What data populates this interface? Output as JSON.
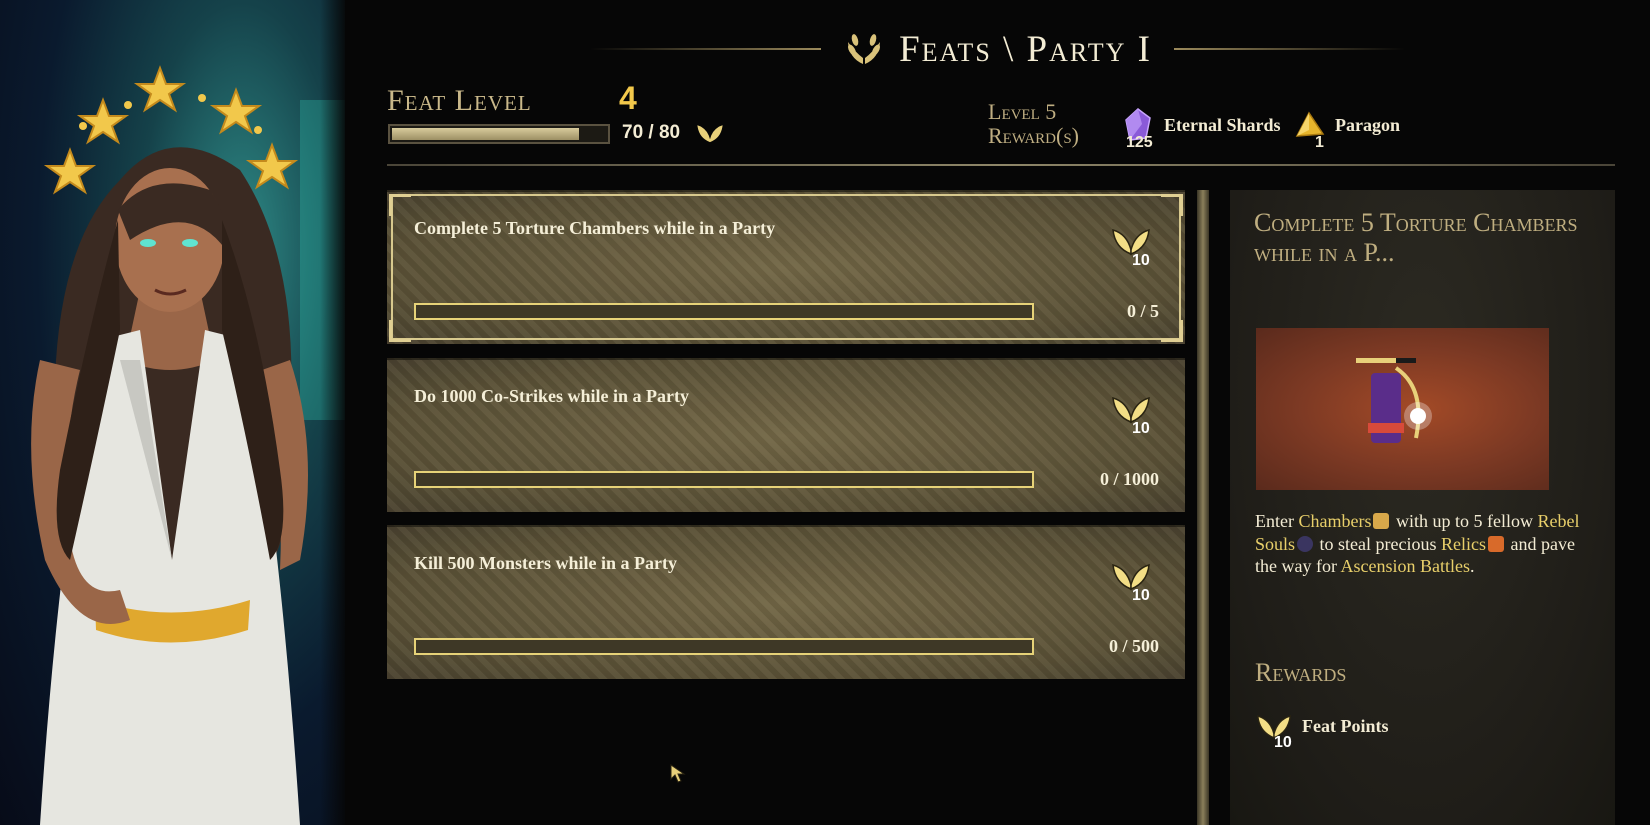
{
  "header": {
    "title": "Feats \\ Party I"
  },
  "feat_level": {
    "label": "Feat Level",
    "value": "4",
    "progress_text": "70 / 80",
    "progress_fraction": 0.875
  },
  "level_reward": {
    "label": "Level 5 Reward(s)",
    "items": [
      {
        "icon": "eternal-shard-icon",
        "count": "125",
        "name": "Eternal Shards"
      },
      {
        "icon": "paragon-icon",
        "count": "1",
        "name": "Paragon"
      }
    ]
  },
  "feats": [
    {
      "title": "Complete 5 Torture Chambers while in a Party",
      "points": "10",
      "progress_text": "0 / 5",
      "progress_fraction": 0,
      "selected": true
    },
    {
      "title": "Do 1000 Co-Strikes while in a Party",
      "points": "10",
      "progress_text": "0 / 1000",
      "progress_fraction": 0,
      "selected": false
    },
    {
      "title": "Kill 500 Monsters while in a Party",
      "points": "10",
      "progress_text": "0 / 500",
      "progress_fraction": 0,
      "selected": false
    }
  ],
  "detail": {
    "title": "Complete 5 Torture Chambers while in a P...",
    "desc": {
      "t1": "Enter ",
      "chambers": "Chambers",
      "t2": " with up to 5 fellow ",
      "rebel_souls": "Rebel Souls",
      "t3": " to steal precious ",
      "relics": "Relics",
      "t4": " and pave the way for ",
      "ascension": "Ascension Battles",
      "t5": "."
    },
    "rewards_heading": "Rewards",
    "reward": {
      "points": "10",
      "name": "Feat Points"
    }
  },
  "colors": {
    "accent_gold": "#f2c84b",
    "progress_bar": "#e6d278",
    "highlight_text": "#e8cf6a",
    "card_bg": "#5b5237"
  }
}
